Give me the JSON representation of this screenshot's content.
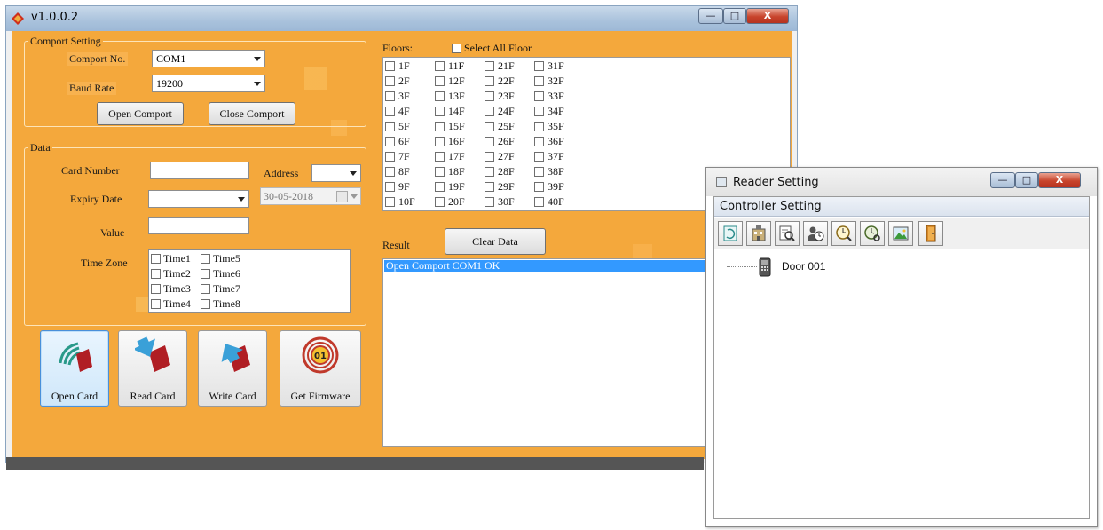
{
  "main_window": {
    "title": "v1.0.0.2",
    "controls": {
      "minimize": "—",
      "maximize": "□",
      "close": "X"
    }
  },
  "comport": {
    "legend": "Comport Setting",
    "port_label": "Comport No.",
    "port_value": "COM1",
    "baud_label": "Baud Rate",
    "baud_value": "19200",
    "open_label": "Open Comport",
    "close_label": "Close Comport"
  },
  "data_group": {
    "legend": "Data",
    "card_number_label": "Card Number",
    "card_number_value": "",
    "address_label": "Address",
    "address_value": "",
    "expiry_label": "Expiry Date",
    "expiry_value": "",
    "expiry_date_display": "30-05-2018",
    "value_label": "Value",
    "value_value": "",
    "timezone_label": "Time Zone",
    "timezones": [
      "Time1",
      "Time2",
      "Time3",
      "Time4",
      "Time5",
      "Time6",
      "Time7",
      "Time8"
    ]
  },
  "action_buttons": [
    {
      "label": "Open Card",
      "icon": "card-wave-icon"
    },
    {
      "label": "Read Card",
      "icon": "card-read-arrow-icon"
    },
    {
      "label": "Write Card",
      "icon": "card-write-arrow-icon"
    },
    {
      "label": "Get Firmware",
      "icon": "firmware-01-icon"
    }
  ],
  "floors": {
    "label": "Floors:",
    "select_all_label": "Select All Floor",
    "items": [
      "1F",
      "2F",
      "3F",
      "4F",
      "5F",
      "6F",
      "7F",
      "8F",
      "9F",
      "10F",
      "11F",
      "12F",
      "13F",
      "14F",
      "15F",
      "16F",
      "17F",
      "18F",
      "19F",
      "20F",
      "21F",
      "22F",
      "23F",
      "24F",
      "25F",
      "26F",
      "27F",
      "28F",
      "29F",
      "30F",
      "31F",
      "32F",
      "33F",
      "34F",
      "35F",
      "36F",
      "37F",
      "38F",
      "39F",
      "40F"
    ]
  },
  "result": {
    "label": "Result",
    "clear_label": "Clear Data",
    "lines": [
      "Open Comport COM1 OK"
    ]
  },
  "reader_window": {
    "title": "Reader Setting",
    "menu": "Controller Setting",
    "controls": {
      "minimize": "—",
      "maximize": "□",
      "close": "X"
    },
    "toolbar_icons": [
      "refresh-icon",
      "building-icon",
      "search-document-icon",
      "user-clock-icon",
      "clock-search-icon",
      "clock-settings-icon",
      "image-icon",
      "door-icon"
    ],
    "tree": [
      {
        "label": "Door 001",
        "icon": "card-reader-icon"
      }
    ]
  },
  "colors": {
    "panel_orange": "#f4a83c",
    "selection_blue": "#3399ff",
    "close_red": "#c8442c"
  }
}
